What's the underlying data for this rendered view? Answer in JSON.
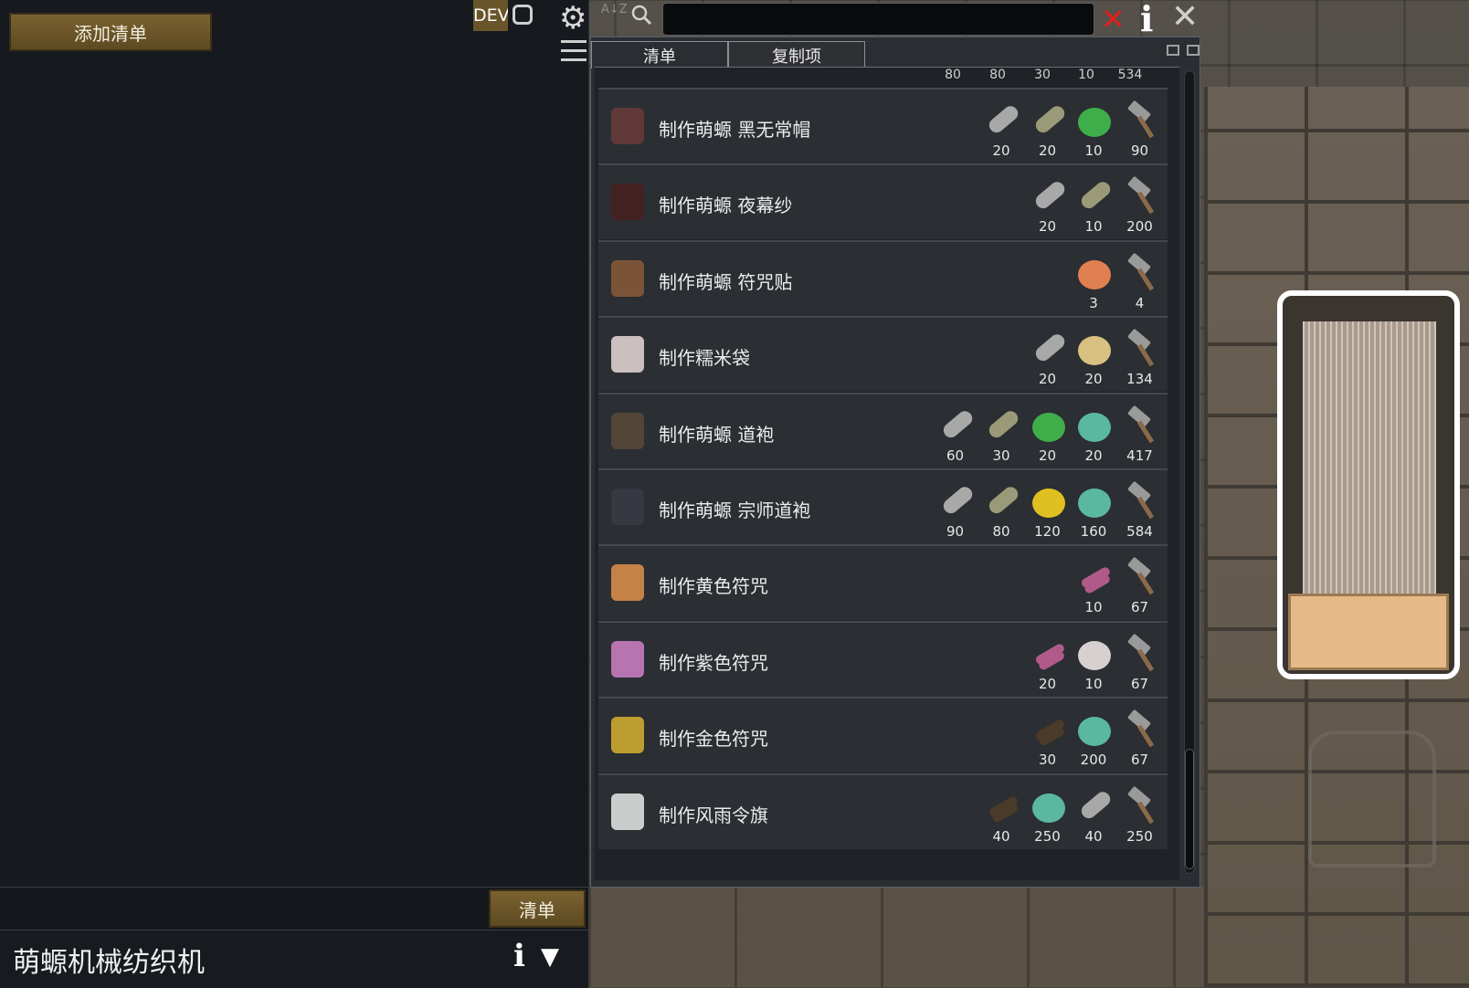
{
  "left_panel": {
    "add_list_label": "添加清单"
  },
  "bottom_bar": {
    "list_tab_label": "清单"
  },
  "inspect": {
    "title": "萌螈机械纺织机",
    "info_icon": "info-icon",
    "collapse_icon": "chevron-down-icon"
  },
  "toolbar": {
    "dev_label": "DEV",
    "sort_label": "A↓Z",
    "search": {
      "value": "",
      "placeholder": ""
    },
    "icons": [
      "square-icon",
      "gear-icon",
      "sort-icon",
      "search-icon",
      "clear-icon",
      "info-icon",
      "close-icon",
      "menu-icon"
    ]
  },
  "window": {
    "tabs": [
      {
        "label": "清单",
        "active": true
      },
      {
        "label": "复制项",
        "active": false
      }
    ],
    "header_numbers": [
      "80",
      "80",
      "30",
      "10",
      "534"
    ],
    "rows": [
      {
        "label": "制作萌螈 黑无常帽",
        "icon": "hat-icon",
        "costs": [
          {
            "mat": "cloth-grey-icon",
            "qty": "20"
          },
          {
            "mat": "cloth-olive-icon",
            "qty": "20"
          },
          {
            "mat": "jade-icon",
            "qty": "10"
          },
          {
            "mat": "hammer-icon",
            "qty": "90"
          }
        ]
      },
      {
        "label": "制作萌螈 夜幕纱",
        "icon": "veil-icon",
        "costs": [
          {
            "mat": "cloth-grey-icon",
            "qty": "20"
          },
          {
            "mat": "cloth-olive-icon",
            "qty": "10"
          },
          {
            "mat": "hammer-icon",
            "qty": "200"
          }
        ]
      },
      {
        "label": "制作萌螈 符咒贴",
        "icon": "talisman-small-icon",
        "costs": [
          {
            "mat": "talisman-red-icon",
            "qty": "3"
          },
          {
            "mat": "hammer-icon",
            "qty": "4"
          }
        ]
      },
      {
        "label": "制作糯米袋",
        "icon": "rice-bag-icon",
        "costs": [
          {
            "mat": "cloth-grey-icon",
            "qty": "20"
          },
          {
            "mat": "rice-icon",
            "qty": "20"
          },
          {
            "mat": "hammer-icon",
            "qty": "134"
          }
        ]
      },
      {
        "label": "制作萌螈 道袍",
        "icon": "robe-icon",
        "costs": [
          {
            "mat": "cloth-grey-icon",
            "qty": "60"
          },
          {
            "mat": "cloth-olive-icon",
            "qty": "30"
          },
          {
            "mat": "jade-icon",
            "qty": "20"
          },
          {
            "mat": "herb-icon",
            "qty": "20"
          },
          {
            "mat": "hammer-icon",
            "qty": "417"
          }
        ]
      },
      {
        "label": "制作萌螈 宗师道袍",
        "icon": "master-robe-icon",
        "costs": [
          {
            "mat": "cloth-grey-icon",
            "qty": "90"
          },
          {
            "mat": "cloth-olive-icon",
            "qty": "80"
          },
          {
            "mat": "gold-icon",
            "qty": "120"
          },
          {
            "mat": "herb-icon",
            "qty": "160"
          },
          {
            "mat": "hammer-icon",
            "qty": "584"
          }
        ]
      },
      {
        "label": "制作黄色符咒",
        "icon": "talisman-yellow-icon",
        "costs": [
          {
            "mat": "logs-purple-icon",
            "qty": "10"
          },
          {
            "mat": "hammer-icon",
            "qty": "67"
          }
        ]
      },
      {
        "label": "制作紫色符咒",
        "icon": "talisman-purple-icon",
        "costs": [
          {
            "mat": "logs-purple-icon",
            "qty": "20"
          },
          {
            "mat": "blood-bowl-icon",
            "qty": "10"
          },
          {
            "mat": "hammer-icon",
            "qty": "67"
          }
        ]
      },
      {
        "label": "制作金色符咒",
        "icon": "talisman-gold-icon",
        "costs": [
          {
            "mat": "logs-dark-icon",
            "qty": "30"
          },
          {
            "mat": "herb-icon",
            "qty": "200"
          },
          {
            "mat": "hammer-icon",
            "qty": "67"
          }
        ]
      },
      {
        "label": "制作风雨令旗",
        "icon": "flag-icon",
        "costs": [
          {
            "mat": "logs-dark-icon",
            "qty": "40"
          },
          {
            "mat": "herb-icon",
            "qty": "250"
          },
          {
            "mat": "cloth-grey-icon",
            "qty": "40"
          },
          {
            "mat": "hammer-icon",
            "qty": "250"
          }
        ]
      }
    ]
  },
  "colors": {
    "accent_button": "#6e5828",
    "close_red": "#e0201e",
    "panel_bg": "#161a1f",
    "window_bg": "#2a2d31"
  }
}
